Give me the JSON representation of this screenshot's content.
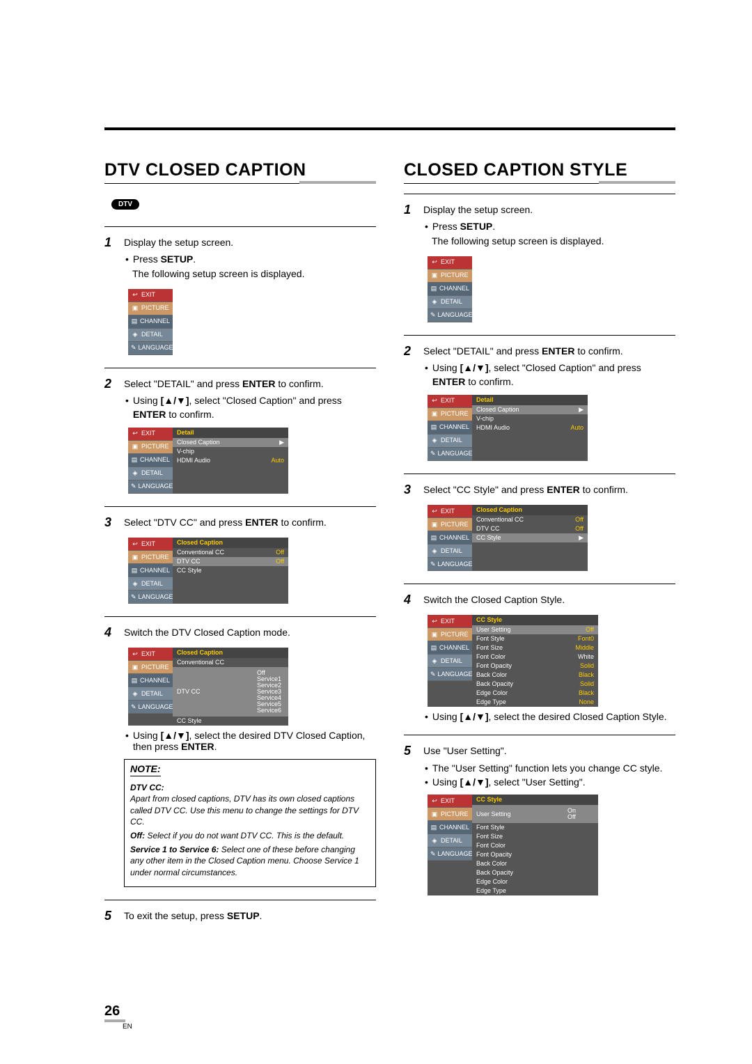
{
  "page": {
    "number": "26",
    "lang": "EN"
  },
  "left": {
    "title": "DTV CLOSED CAPTION",
    "badge": "DTV",
    "step1": {
      "num": "1",
      "text": "Display the setup screen.",
      "b1_pre": "Press ",
      "b1_key": "SETUP",
      "b1_post": ".",
      "after": "The following setup screen is displayed."
    },
    "step2": {
      "num": "2",
      "pre": "Select \"DETAIL\" and press ",
      "key": "ENTER",
      "post": " to confirm.",
      "b1_pre": "Using ",
      "b1_key": "[▲/▼]",
      "b1_mid": ", select \"Closed Caption\" and press ",
      "b1_key2": "ENTER",
      "b1_post": " to confirm."
    },
    "step3": {
      "num": "3",
      "pre": "Select \"DTV CC\" and press ",
      "key": "ENTER",
      "post": " to confirm."
    },
    "step4": {
      "num": "4",
      "text": "Switch the DTV Closed Caption mode.",
      "b1_pre": "Using ",
      "b1_key": "[▲/▼]",
      "b1_mid": ", select the desired DTV Closed Caption, then press ",
      "b1_key2": "ENTER",
      "b1_post": "."
    },
    "step5": {
      "num": "5",
      "pre": "To exit the setup, press ",
      "key": "SETUP",
      "post": "."
    }
  },
  "right": {
    "title": "CLOSED CAPTION STYLE",
    "step1": {
      "num": "1",
      "text": "Display the setup screen.",
      "b1_pre": "Press ",
      "b1_key": "SETUP",
      "b1_post": ".",
      "after": "The following setup screen is displayed."
    },
    "step2": {
      "num": "2",
      "pre": "Select \"DETAIL\" and press ",
      "key": "ENTER",
      "post": " to confirm.",
      "b1_pre": "Using ",
      "b1_key": "[▲/▼]",
      "b1_mid": ", select \"Closed Caption\" and press ",
      "b1_key2": "ENTER",
      "b1_post": " to confirm."
    },
    "step3": {
      "num": "3",
      "pre": "Select \"CC Style\" and press  ",
      "key": "ENTER",
      "post": " to confirm."
    },
    "step4": {
      "num": "4",
      "text": "Switch the Closed Caption Style.",
      "b1_pre": "Using ",
      "b1_key": "[▲/▼]",
      "b1_mid": ", select the desired Closed Caption Style.",
      "b1_post": ""
    },
    "step5": {
      "num": "5",
      "text": "Use \"User Setting\".",
      "b1": "The \"User Setting\" function lets you change CC style.",
      "b2_pre": "Using ",
      "b2_key": "[▲/▼]",
      "b2_post": ", select \"User Setting\"."
    }
  },
  "side": {
    "exit": "EXIT",
    "picture": "PICTURE",
    "channel": "CHANNEL",
    "detail": "DETAIL",
    "language": "LANGUAGE"
  },
  "menus": {
    "detail_head": "Detail",
    "closed_caption": "Closed Caption",
    "vchip": "V-chip",
    "hdmi_audio": "HDMI Audio",
    "auto": "Auto",
    "cc_head": "Closed Caption",
    "conv_cc": "Conventional CC",
    "dtv_cc": "DTV CC",
    "cc_style": "CC Style",
    "off": "Off",
    "on": "On",
    "svc1": "Service1",
    "svc2": "Service2",
    "svc3": "Service3",
    "svc4": "Service4",
    "svc5": "Service5",
    "svc6": "Service6",
    "style_head": "CC Style",
    "user_setting": "User Setting",
    "font_style": "Font Style",
    "font_size": "Font Size",
    "font_color": "Font Color",
    "font_opacity": "Font Opacity",
    "back_color": "Back Color",
    "back_opacity": "Back Opacity",
    "edge_color": "Edge Color",
    "edge_type": "Edge Type",
    "vals": {
      "font0": "Font0",
      "middle": "Middle",
      "white": "White",
      "solid": "Solid",
      "black": "Black",
      "none": "None"
    }
  },
  "note": {
    "title": "NOTE:",
    "subtitle": "DTV CC:",
    "p1": "Apart from closed captions, DTV has its own closed captions called DTV CC. Use this menu to change the settings for DTV CC.",
    "p2_pre": "Off: ",
    "p2": "Select if you do not want DTV CC. This is the default.",
    "p3_pre": "Service 1 to Service 6: ",
    "p3": "Select one of these before changing any other item in the Closed Caption menu. Choose Service 1 under normal circumstances."
  }
}
